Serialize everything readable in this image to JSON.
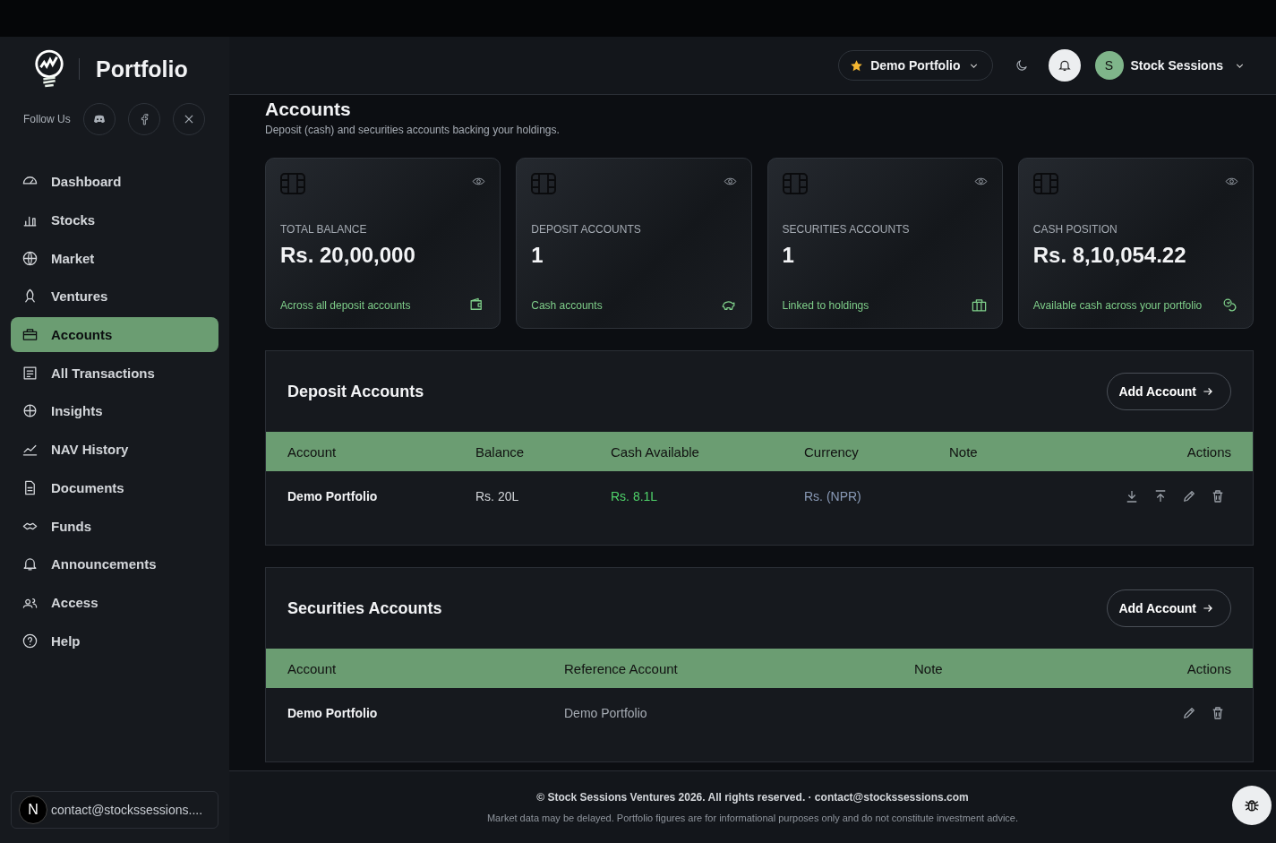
{
  "brand": {
    "title": "Portfolio",
    "follow_label": "Follow Us"
  },
  "sidebar": {
    "items": [
      {
        "label": "Dashboard",
        "selected": false
      },
      {
        "label": "Stocks",
        "selected": false
      },
      {
        "label": "Market",
        "selected": false
      },
      {
        "label": "Ventures",
        "selected": false
      },
      {
        "label": "Accounts",
        "selected": true
      },
      {
        "label": "All Transactions",
        "selected": false
      },
      {
        "label": "Insights",
        "selected": false
      },
      {
        "label": "NAV History",
        "selected": false
      },
      {
        "label": "Documents",
        "selected": false
      },
      {
        "label": "Funds",
        "selected": false
      },
      {
        "label": "Announcements",
        "selected": false
      },
      {
        "label": "Access",
        "selected": false
      },
      {
        "label": "Help",
        "selected": false
      }
    ],
    "user": {
      "avatar": "N",
      "email": "contact@stockssessions...."
    }
  },
  "header": {
    "portfolio": "Demo Portfolio",
    "user_initial": "S",
    "user_name": "Stock Sessions"
  },
  "page": {
    "title": "Accounts",
    "subtitle": "Deposit (cash) and securities accounts backing your holdings."
  },
  "cards": [
    {
      "label": "TOTAL BALANCE",
      "value": "Rs. 20,00,000",
      "note": "Across all deposit accounts"
    },
    {
      "label": "DEPOSIT ACCOUNTS",
      "value": "1",
      "note": "Cash accounts"
    },
    {
      "label": "SECURITIES ACCOUNTS",
      "value": "1",
      "note": "Linked to holdings"
    },
    {
      "label": "CASH POSITION",
      "value": "Rs. 8,10,054.22",
      "note": "Available cash across your portfolio"
    }
  ],
  "sections": [
    {
      "title": "Deposit Accounts",
      "button": "Add Account",
      "columns": [
        "Account",
        "Balance",
        "Cash Available",
        "Currency",
        "Note",
        "Actions"
      ],
      "rows": [
        {
          "cells": [
            "Demo Portfolio",
            "Rs. 20L",
            "Rs. 8.1L",
            "Rs. (NPR)",
            ""
          ],
          "actions": [
            {
              "kind": "download"
            },
            {
              "kind": "upload"
            },
            {
              "kind": "edit"
            },
            {
              "kind": "delete"
            }
          ]
        }
      ]
    },
    {
      "title": "Securities Accounts",
      "button": "Add Account",
      "columns": [
        "Account",
        "Reference Account",
        "Note",
        "Actions"
      ],
      "rows": [
        {
          "cells": [
            "Demo Portfolio",
            "Demo Portfolio",
            ""
          ],
          "actions": [
            {
              "kind": "edit"
            },
            {
              "kind": "delete"
            }
          ]
        }
      ]
    }
  ],
  "footer": {
    "copyright": "© Stock Sessions Ventures 2026. All rights reserved. · contact@stockssessions.com",
    "disclaimer": "Market data may be delayed. Portfolio figures are for informational purposes only and do not constitute investment advice."
  }
}
